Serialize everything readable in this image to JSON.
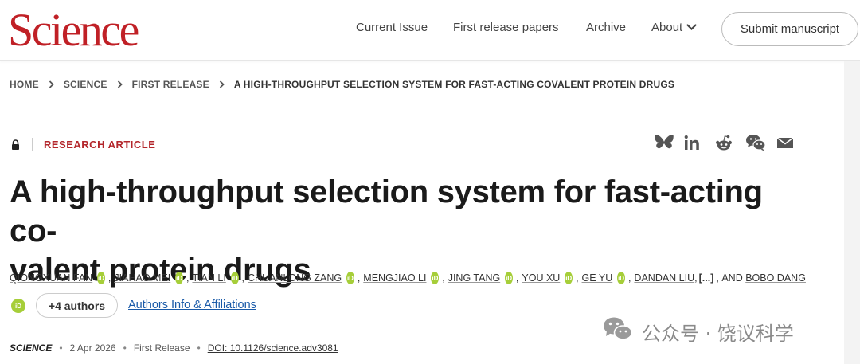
{
  "header": {
    "logo_text": "Science",
    "nav": {
      "current_issue": "Current Issue",
      "first_release": "First release papers",
      "archive": "Archive",
      "about": "About"
    },
    "submit_label": "Submit manuscript"
  },
  "breadcrumb": [
    "HOME",
    "SCIENCE",
    "FIRST RELEASE",
    "A HIGH-THROUGHPUT SELECTION SYSTEM FOR FAST-ACTING COVALENT PROTEIN DRUGS"
  ],
  "article": {
    "type": "RESEARCH ARTICLE",
    "title_line1": "A high-throughput selection system for fast-acting co-",
    "title_line2": "valent protein drugs",
    "authors": [
      "QIONGXUAN FAN",
      "JIAHAO MEI",
      "TIAN LI",
      "CHUANLONG ZANG",
      "MENGJIAO LI",
      "JING TANG",
      "YOU XU",
      "GE YU",
      "DANDAN LIU"
    ],
    "ellipsis": "[...]",
    "and_text": "AND",
    "last_author": "BOBO DANG",
    "orcid_label": "iD",
    "more_authors": "+4 authors",
    "affiliations_link": "Authors Info & Affiliations",
    "journal": "SCIENCE",
    "date": "2 Apr 2026",
    "release": "First Release",
    "doi": "DOI: 10.1126/science.adv3081"
  },
  "share_icons": [
    "bluesky-icon",
    "linkedin-icon",
    "reddit-icon",
    "wechat-icon",
    "email-icon"
  ],
  "watermark": {
    "text": "公众号 · 饶议科学"
  },
  "colors": {
    "brand_red": "#c02026",
    "article_type_red": "#b3262b",
    "orcid_green": "#a6ce39",
    "link_blue": "#1a5aa8"
  }
}
